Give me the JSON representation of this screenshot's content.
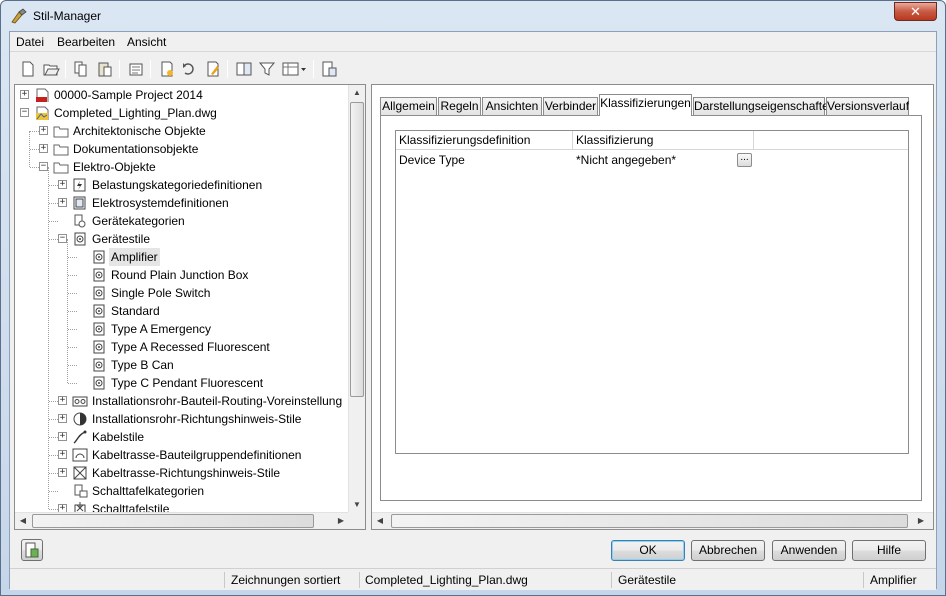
{
  "window": {
    "title": "Stil-Manager",
    "close_glyph": "✕"
  },
  "menu": {
    "items": [
      "Datei",
      "Bearbeiten",
      "Ansicht"
    ]
  },
  "toolbar": {
    "icons": [
      "new-icon",
      "open-icon",
      "copy-icon",
      "paste-icon",
      "purge-icon",
      "new-style-icon",
      "set-from-icon",
      "edit-style-icon",
      "compare-icon",
      "filter-icon",
      "view-icon",
      "toggle-view-icon"
    ]
  },
  "tree": {
    "items": [
      {
        "label": "00000-Sample Project 2014",
        "icon": "pdf-project-icon"
      },
      {
        "label": "Completed_Lighting_Plan.dwg",
        "icon": "drawing-icon"
      },
      {
        "label": "Architektonische Objekte",
        "icon": "folder-icon"
      },
      {
        "label": "Dokumentationsobjekte",
        "icon": "folder-icon"
      },
      {
        "label": "Elektro-Objekte",
        "icon": "folder-icon"
      },
      {
        "label": "Belastungskategoriedefinitionen",
        "icon": "load-category-icon"
      },
      {
        "label": "Elektrosystemdefinitionen",
        "icon": "electrical-system-icon"
      },
      {
        "label": "Gerätekategorien",
        "icon": "device-category-icon"
      },
      {
        "label": "Gerätestile",
        "icon": "device-style-icon"
      },
      {
        "label": "Amplifier",
        "icon": "device-style-icon"
      },
      {
        "label": "Round Plain Junction Box",
        "icon": "device-style-icon"
      },
      {
        "label": "Single Pole Switch",
        "icon": "device-style-icon"
      },
      {
        "label": "Standard",
        "icon": "device-style-icon"
      },
      {
        "label": "Type A Emergency",
        "icon": "device-style-icon"
      },
      {
        "label": "Type A Recessed Fluorescent",
        "icon": "device-style-icon"
      },
      {
        "label": "Type B Can",
        "icon": "device-style-icon"
      },
      {
        "label": "Type C Pendant Fluorescent",
        "icon": "device-style-icon"
      },
      {
        "label": "Installationsrohr-Bauteil-Routing-Voreinstellung",
        "icon": "conduit-routing-icon"
      },
      {
        "label": "Installationsrohr-Richtungshinweis-Stile",
        "icon": "conduit-rise-drop-icon"
      },
      {
        "label": "Kabelstile",
        "icon": "wire-style-icon"
      },
      {
        "label": "Kabeltrasse-Bauteilgruppendefinitionen",
        "icon": "cable-tray-group-icon"
      },
      {
        "label": "Kabeltrasse-Richtungshinweis-Stile",
        "icon": "cable-tray-rise-drop-icon"
      },
      {
        "label": "Schalttafelkategorien",
        "icon": "panel-category-icon"
      },
      {
        "label": "Schalttafelstile",
        "icon": "panel-style-icon"
      }
    ],
    "selected": "Amplifier"
  },
  "tabs": {
    "items": [
      "Allgemein",
      "Regeln",
      "Ansichten",
      "Verbinder",
      "Klassifizierungen",
      "Darstellungseigenschaften",
      "Versionsverlauf"
    ],
    "active": "Klassifizierungen"
  },
  "classification_grid": {
    "headers": [
      "Klassifizierungsdefinition",
      "Klassifizierung"
    ],
    "rows": [
      {
        "definition": "Device Type",
        "value": "*Nicht angegeben*",
        "button": "..."
      }
    ]
  },
  "buttons": {
    "ok": "OK",
    "cancel": "Abbrechen",
    "apply": "Anwenden",
    "help": "Hilfe"
  },
  "statusbar": {
    "sort": "Zeichnungen sortiert",
    "drawing": "Completed_Lighting_Plan.dwg",
    "category": "Gerätestile",
    "style": "Amplifier"
  },
  "colors": {
    "accent": "#3c7fb1",
    "selection": "#e5e5e5",
    "titlebar": "#c6d6ea",
    "close": "#c75a43"
  }
}
